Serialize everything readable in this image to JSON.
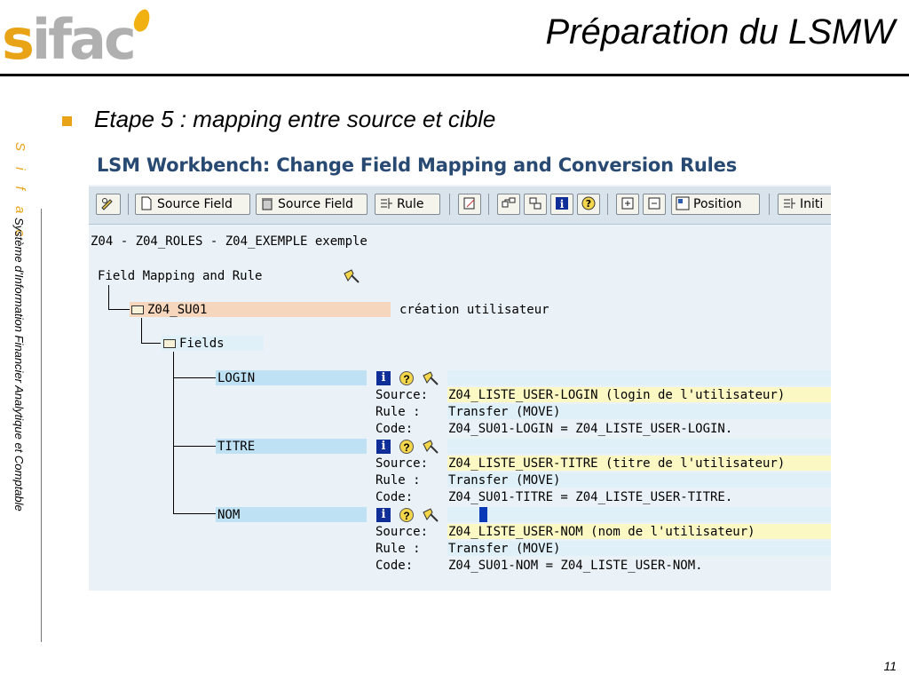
{
  "slide": {
    "logo_text": "sifac",
    "title": "Préparation du LSMW",
    "side_brand": "S i f a c",
    "side_desc": "Système d'Information Financier Analytique et Comptable",
    "bullet": "Etape 5 : mapping entre source et cible",
    "page_number": "11"
  },
  "sap": {
    "window_title": "LSM Workbench: Change Field Mapping and Conversion Rules",
    "toolbar": {
      "source_field_1": "Source Field",
      "source_field_2": "Source Field",
      "rule": "Rule",
      "position": "Position",
      "initial": "Initi"
    },
    "header_line": "Z04 - Z04_ROLES - Z04_EXEMPLE exemple",
    "tree": {
      "root_label": "Field Mapping and Rule",
      "object_name": "Z04_SU01",
      "object_desc": "création utilisateur",
      "fields_label": "Fields",
      "fields": [
        {
          "name": "LOGIN",
          "source_label": "Source:",
          "source_value": "Z04_LISTE_USER-LOGIN (login de l'utilisateur)",
          "rule_label": "Rule :",
          "rule_value": "Transfer (MOVE)",
          "code_label": "Code:",
          "code_value": "Z04_SU01-LOGIN = Z04_LISTE_USER-LOGIN."
        },
        {
          "name": "TITRE",
          "source_label": "Source:",
          "source_value": "Z04_LISTE_USER-TITRE (titre de l'utilisateur)",
          "rule_label": "Rule :",
          "rule_value": "Transfer (MOVE)",
          "code_label": "Code:",
          "code_value": "Z04_SU01-TITRE = Z04_LISTE_USER-TITRE."
        },
        {
          "name": "NOM",
          "source_label": "Source:",
          "source_value": "Z04_LISTE_USER-NOM (nom de l'utilisateur)",
          "rule_label": "Rule :",
          "rule_value": "Transfer (MOVE)",
          "code_label": "Code:",
          "code_value": "Z04_SU01-NOM = Z04_LISTE_USER-NOM."
        }
      ]
    }
  },
  "colors": {
    "accent_orange": "#e8a317",
    "sap_title_blue": "#284a72",
    "highlight_orange": "#f6d7bd",
    "highlight_blue": "#bfe1f4",
    "highlight_yellow": "#fbf8c4"
  }
}
